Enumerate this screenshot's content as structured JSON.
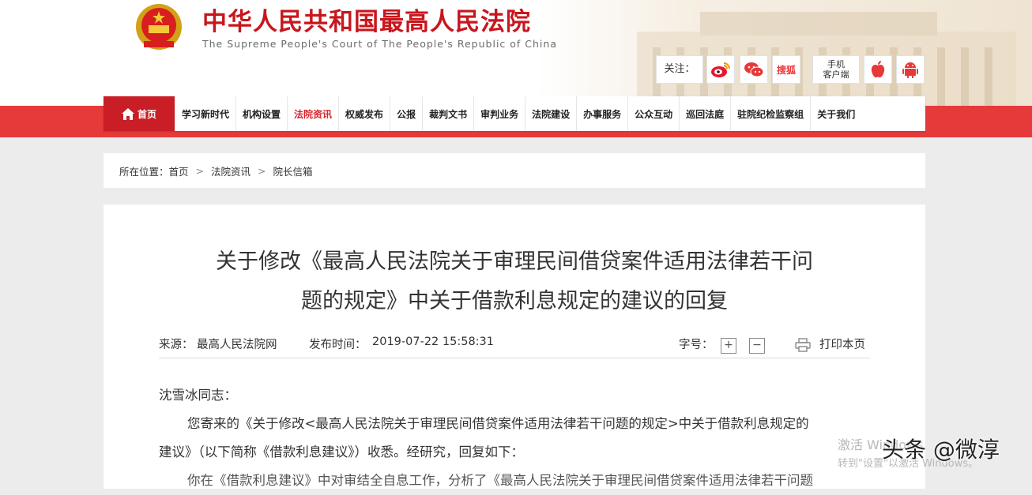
{
  "header": {
    "title": "中华人民共和国最高人民法院",
    "subtitle": "The Supreme People's Court of The People's Republic of China",
    "follow_label": "关注：",
    "social": [
      {
        "icon": "weibo-icon",
        "color": "#e6162d"
      },
      {
        "icon": "wechat-icon",
        "color": "#2aae67"
      },
      {
        "icon": "sohu-icon",
        "label": "搜狐",
        "color": "#e33333"
      },
      {
        "icon": "mobile-client",
        "label_line1": "手机",
        "label_line2": "客户端"
      },
      {
        "icon": "apple-icon",
        "color": "#e63a3a"
      },
      {
        "icon": "android-icon",
        "color": "#e63a3a"
      }
    ]
  },
  "nav": {
    "items": [
      "首页",
      "学习新时代",
      "机构设置",
      "法院资讯",
      "权威发布",
      "公报",
      "裁判文书",
      "审判业务",
      "法院建设",
      "办事服务",
      "公众互动",
      "巡回法庭",
      "驻院纪检监察组",
      "关于我们"
    ],
    "active_index": 3
  },
  "breadcrumb": {
    "prefix": "所在位置：",
    "items": [
      "首页",
      "法院资讯",
      "院长信箱"
    ],
    "separator": ">"
  },
  "article": {
    "title_line1": "关于修改《最高人民法院关于审理民间借贷案件适用法律若干问",
    "title_line2": "题的规定》中关于借款利息规定的建议的回复",
    "source_label": "来源：",
    "source": "最高人民法院网",
    "time_label": "发布时间：",
    "time": "2019-07-22 15:58:31",
    "font_size_label": "字号：",
    "font_plus": "+",
    "font_minus": "−",
    "print_label": "打印本页",
    "paragraphs": [
      "沈雪冰同志：",
      "您寄来的《关于修改<最高人民法院关于审理民间借贷案件适用法律若干问题的规定>中关于借款利息规定的",
      "建议》（以下简称《借款利息建议》）收悉。经研究，回复如下：",
      "你在《借款利息建议》中对审结全自息工作，分析了《最高人民法院关于审理民间借贷案件适用法律若干问题"
    ]
  },
  "overlay": {
    "activate_line1": "激活 Windows",
    "activate_line2": "转到\"设置\"以激活 Windows。",
    "toutiao": "头条 @微淳"
  },
  "colors": {
    "brand_red": "#c8161d",
    "nav_red": "#e63a3a",
    "home_red": "#c91e25"
  }
}
